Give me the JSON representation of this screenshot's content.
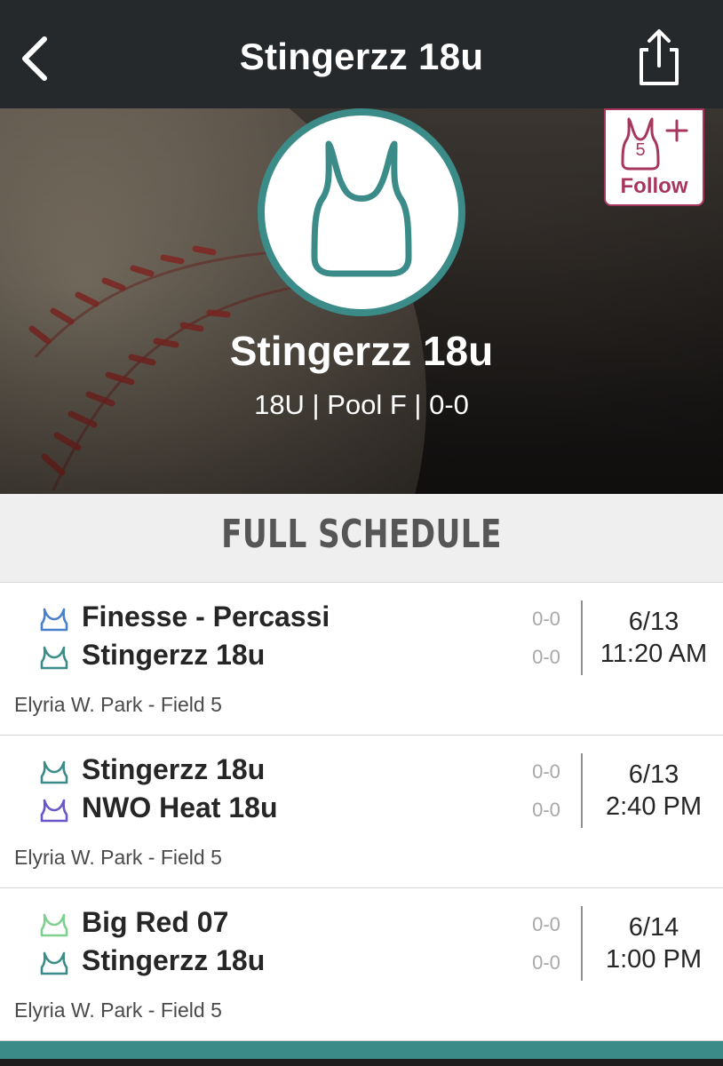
{
  "header": {
    "title": "Stingerzz 18u",
    "back_icon": "chevron-left-icon",
    "share_icon": "share-icon"
  },
  "hero": {
    "team_name": "Stingerzz 18u",
    "team_meta": "18U | Pool F | 0-0",
    "avatar_icon": "jersey-icon",
    "follow": {
      "label": "Follow",
      "badge": "5",
      "icon": "jersey-plus-icon",
      "color": "#a7365f"
    }
  },
  "schedule": {
    "title": "FULL SCHEDULE",
    "games": [
      {
        "teams": [
          {
            "name": "Finesse - Percassi",
            "score": "0-0",
            "jersey_color": "#4a7fc9"
          },
          {
            "name": "Stingerzz 18u",
            "score": "0-0",
            "jersey_color": "#3b8c88"
          }
        ],
        "date": "6/13",
        "time": "11:20 AM",
        "venue": "Elyria W. Park - Field 5"
      },
      {
        "teams": [
          {
            "name": "Stingerzz 18u",
            "score": "0-0",
            "jersey_color": "#3b8c88"
          },
          {
            "name": "NWO Heat 18u",
            "score": "0-0",
            "jersey_color": "#6a56c9"
          }
        ],
        "date": "6/13",
        "time": "2:40 PM",
        "venue": "Elyria W. Park - Field 5"
      },
      {
        "teams": [
          {
            "name": "Big Red 07",
            "score": "0-0",
            "jersey_color": "#7fd08f"
          },
          {
            "name": "Stingerzz 18u",
            "score": "0-0",
            "jersey_color": "#3b8c88"
          }
        ],
        "date": "6/14",
        "time": "1:00 PM",
        "venue": "Elyria W. Park - Field 5"
      }
    ]
  },
  "colors": {
    "accent": "#3b8c88",
    "topbar": "#25292b",
    "follow": "#a7365f"
  }
}
